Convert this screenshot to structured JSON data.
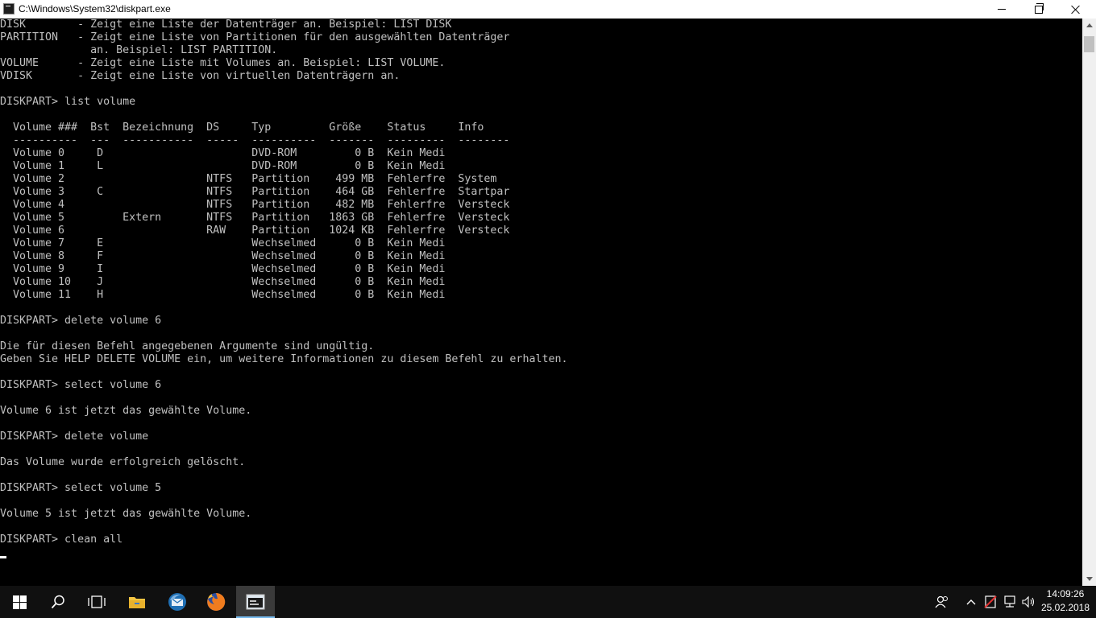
{
  "window": {
    "title": "C:\\Windows\\System32\\diskpart.exe",
    "icon": "console-icon",
    "controls": {
      "minimize": "minimize-icon",
      "maximize": "restore-icon",
      "close": "close-icon"
    }
  },
  "console": {
    "lines": [
      "DISK        - Zeigt eine Liste der Datenträger an. Beispiel: LIST DISK",
      "PARTITION   - Zeigt eine Liste von Partitionen für den ausgewählten Datenträger",
      "              an. Beispiel: LIST PARTITION.",
      "VOLUME      - Zeigt eine Liste mit Volumes an. Beispiel: LIST VOLUME.",
      "VDISK       - Zeigt eine Liste von virtuellen Datenträgern an.",
      "",
      "DISKPART> list volume",
      "",
      "  Volume ###  Bst  Bezeichnung  DS     Typ         Größe    Status     Info",
      "  ----------  ---  -----------  -----  ----------  -------  ---------  --------",
      "  Volume 0     D                       DVD-ROM         0 B  Kein Medi",
      "  Volume 1     L                       DVD-ROM         0 B  Kein Medi",
      "  Volume 2                      NTFS   Partition    499 MB  Fehlerfre  System",
      "  Volume 3     C                NTFS   Partition    464 GB  Fehlerfre  Startpar",
      "  Volume 4                      NTFS   Partition    482 MB  Fehlerfre  Versteck",
      "  Volume 5         Extern       NTFS   Partition   1863 GB  Fehlerfre  Versteck",
      "  Volume 6                      RAW    Partition   1024 KB  Fehlerfre  Versteck",
      "  Volume 7     E                       Wechselmed      0 B  Kein Medi",
      "  Volume 8     F                       Wechselmed      0 B  Kein Medi",
      "  Volume 9     I                       Wechselmed      0 B  Kein Medi",
      "  Volume 10    J                       Wechselmed      0 B  Kein Medi",
      "  Volume 11    H                       Wechselmed      0 B  Kein Medi",
      "",
      "DISKPART> delete volume 6",
      "",
      "Die für diesen Befehl angegebenen Argumente sind ungültig.",
      "Geben Sie HELP DELETE VOLUME ein, um weitere Informationen zu diesem Befehl zu erhalten.",
      "",
      "DISKPART> select volume 6",
      "",
      "Volume 6 ist jetzt das gewählte Volume.",
      "",
      "DISKPART> delete volume",
      "",
      "Das Volume wurde erfolgreich gelöscht.",
      "",
      "DISKPART> select volume 5",
      "",
      "Volume 5 ist jetzt das gewählte Volume.",
      "",
      "DISKPART> clean all"
    ]
  },
  "taskbar": {
    "apps": [
      {
        "name": "start-button",
        "icon": "windows-logo-icon"
      },
      {
        "name": "search-button",
        "icon": "search-icon"
      },
      {
        "name": "task-view-button",
        "icon": "task-view-icon"
      },
      {
        "name": "file-explorer-button",
        "icon": "folder-icon"
      },
      {
        "name": "thunderbird-button",
        "icon": "thunderbird-icon"
      },
      {
        "name": "firefox-button",
        "icon": "firefox-icon"
      },
      {
        "name": "diskpart-taskbar-button",
        "icon": "console-icon",
        "active": true
      }
    ],
    "tray": [
      "people-icon",
      "chevron-up-icon",
      "action-center-warning-icon",
      "network-icon",
      "volume-icon"
    ],
    "clock": {
      "time": "14:09:26",
      "date": "25.02.2018"
    }
  },
  "colors": {
    "console_bg": "#000000",
    "console_fg": "#c0c0c0",
    "taskbar_bg": "#101010",
    "accent": "#76b9ed"
  }
}
